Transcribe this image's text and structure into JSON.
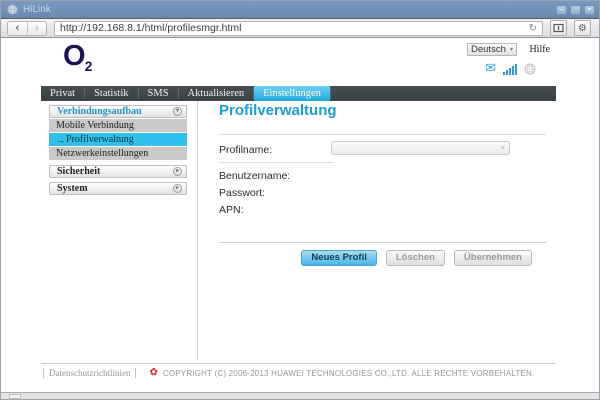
{
  "window": {
    "title": "HiLink",
    "controls": {
      "minimize": "–",
      "maximize": "▫",
      "close": "▪"
    }
  },
  "browser": {
    "back_glyph": "‹",
    "forward_glyph": "›",
    "url": "http://192.168.8.1/html/profilesmgr.html",
    "refresh_glyph": "↻",
    "gear_glyph": "⚙"
  },
  "header": {
    "logo": {
      "text": "O",
      "sub": "2"
    },
    "language": "Deutsch",
    "language_chevron": "▾",
    "help": "Hilfe",
    "mail_glyph": "✉"
  },
  "nav": {
    "items": [
      "Privat",
      "Statistik",
      "SMS",
      "Aktualisieren",
      "Einstellungen"
    ],
    "active": "Einstellungen"
  },
  "sidebar": {
    "active_prefix": "→",
    "expanded_glyph": "▾",
    "collapsed_glyph": "▸",
    "sections": [
      {
        "label": "Verbindungsaufbau",
        "expanded": true,
        "items": [
          "Mobile Verbindung",
          "Profilverwaltung",
          "Netzwerkeinstellungen"
        ],
        "active_item": "Profilverwaltung"
      },
      {
        "label": "Sicherheit",
        "expanded": false
      },
      {
        "label": "System",
        "expanded": false
      }
    ]
  },
  "main": {
    "title": "Profilverwaltung",
    "fields": [
      {
        "label": "Profilname:",
        "type": "select",
        "value": ""
      },
      {
        "label": "Benutzername:",
        "value": ""
      },
      {
        "label": "Passwort:",
        "value": ""
      },
      {
        "label": "APN:",
        "value": ""
      }
    ],
    "select_chevron": "˅",
    "buttons": [
      {
        "label": "Neues Profil",
        "primary": true
      },
      {
        "label": "Löschen",
        "primary": false
      },
      {
        "label": "Übernehmen",
        "primary": false
      }
    ]
  },
  "footer": {
    "privacy": "Datenschutzrichtlinien",
    "flower_glyph": "✿",
    "copyright": "COPYRIGHT (C) 2006-2013 HUAWEI TECHNOLOGIES CO.,LTD. ALLE RECHTE VORBEHALTEN."
  },
  "colors": {
    "accent_cyan": "#1fa8dc",
    "nav_dark": "#41484b",
    "sidebar_active": "#2fc0eb",
    "o2_navy": "#1c1356",
    "huawei_red": "#e21c21",
    "titlebar_blue": "#7b99c0"
  }
}
